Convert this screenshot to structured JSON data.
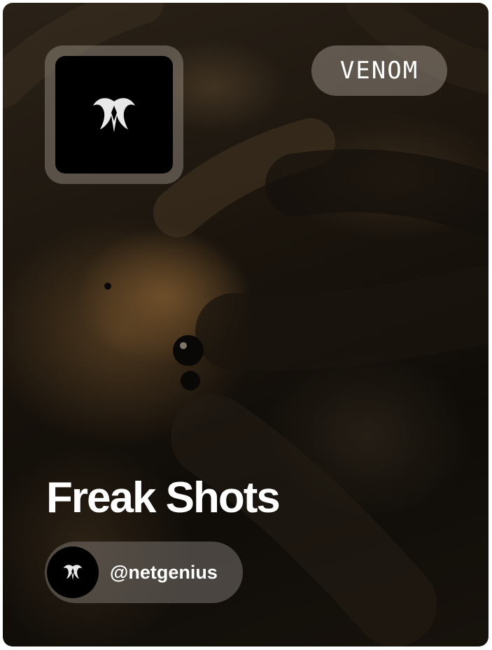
{
  "collection": {
    "title": "Freak Shots",
    "tag": "VENOM",
    "logo_icon": "venom-spider-logo-icon",
    "background_image": "tarantula-closeup-photo"
  },
  "author": {
    "handle": "@netgenius",
    "avatar_icon": "venom-spider-avatar-icon"
  },
  "colors": {
    "logo_background": "#000000",
    "text": "#ffffff"
  }
}
